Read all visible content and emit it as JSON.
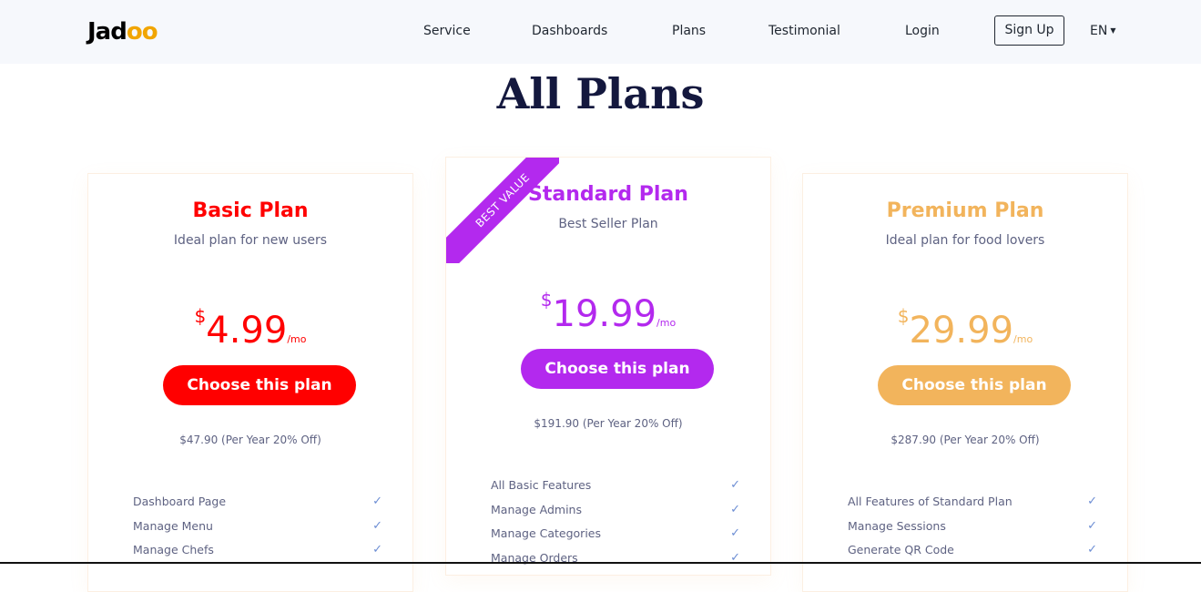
{
  "brand": {
    "logo_prefix": "Jad",
    "logo_accent": "oo"
  },
  "nav": {
    "links": [
      "Service",
      "Dashboards",
      "Plans",
      "Testimonial",
      "Login"
    ],
    "signup": "Sign Up",
    "language": "EN"
  },
  "page_title": "All Plans",
  "plans": [
    {
      "name": "Basic Plan",
      "subtitle": "Ideal plan for new users",
      "currency": "$",
      "price": "4.99",
      "period": "/mo",
      "cta": "Choose this plan",
      "yearly": "$47.90 (Per Year 20% Off)",
      "color": "#ff0000",
      "features": [
        "Dashboard Page",
        "Manage Menu",
        "Manage Chefs"
      ]
    },
    {
      "name": "Standard Plan",
      "subtitle": "Best Seller Plan",
      "currency": "$",
      "price": "19.99",
      "period": "/mo",
      "cta": "Choose this plan",
      "yearly": "$191.90 (Per Year 20% Off)",
      "color": "#b329ee",
      "ribbon": "BEST VALUE",
      "features": [
        "All Basic Features",
        "Manage Admins",
        "Manage Categories",
        "Manage Orders"
      ]
    },
    {
      "name": "Premium Plan",
      "subtitle": "Ideal plan for food lovers",
      "currency": "$",
      "price": "29.99",
      "period": "/mo",
      "cta": "Choose this plan",
      "yearly": "$287.90 (Per Year 20% Off)",
      "color": "#f2b45c",
      "features": [
        "All Features of Standard Plan",
        "Manage Sessions",
        "Generate QR Code"
      ]
    }
  ],
  "icons": {
    "check": "check-icon",
    "caret": "caret-down-icon"
  }
}
